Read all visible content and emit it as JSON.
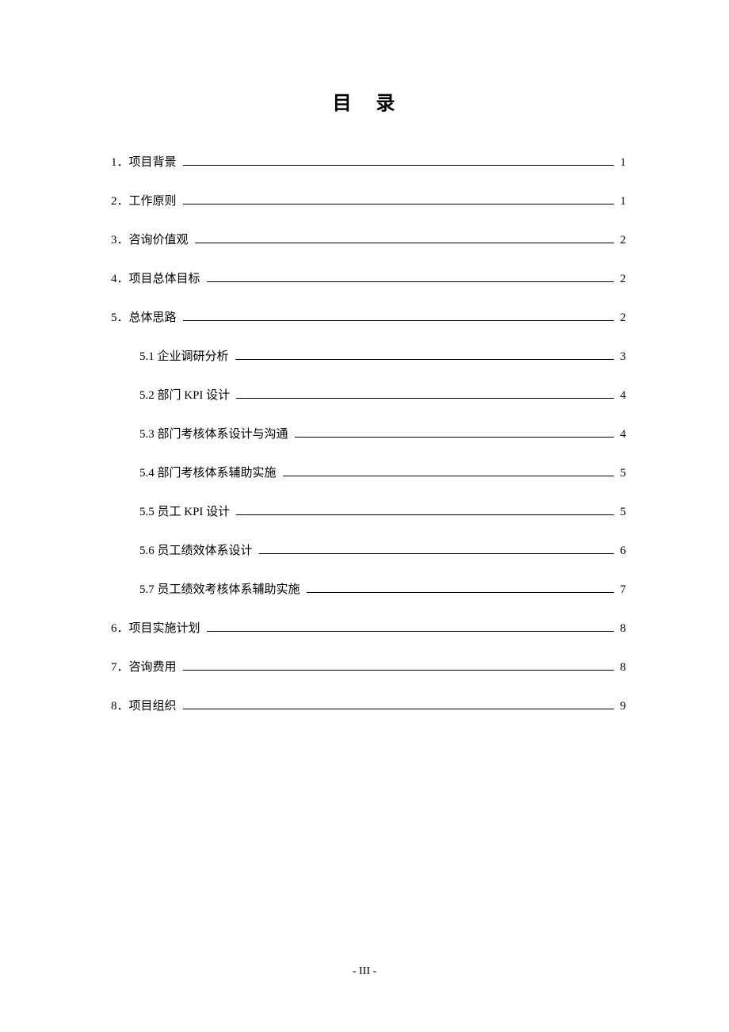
{
  "title": "目 录",
  "entries": [
    {
      "level": 1,
      "label": "1．项目背景",
      "page": "1"
    },
    {
      "level": 1,
      "label": "2．工作原则",
      "page": "1"
    },
    {
      "level": 1,
      "label": "3．咨询价值观",
      "page": "2"
    },
    {
      "level": 1,
      "label": "4．项目总体目标",
      "page": "2"
    },
    {
      "level": 1,
      "label": "5．总体思路",
      "page": "2"
    },
    {
      "level": 2,
      "label": "5.1  企业调研分析",
      "page": "3"
    },
    {
      "level": 2,
      "label": "5.2  部门 KPI 设计",
      "page": "4"
    },
    {
      "level": 2,
      "label": "5.3  部门考核体系设计与沟通",
      "page": "4"
    },
    {
      "level": 2,
      "label": "5.4  部门考核体系辅助实施",
      "page": "5"
    },
    {
      "level": 2,
      "label": "5.5  员工 KPI 设计",
      "page": "5"
    },
    {
      "level": 2,
      "label": "5.6  员工绩效体系设计",
      "page": "6"
    },
    {
      "level": 2,
      "label": "5.7  员工绩效考核体系辅助实施",
      "page": "7"
    },
    {
      "level": 1,
      "label": "6．项目实施计划",
      "page": "8"
    },
    {
      "level": 1,
      "label": "7．咨询费用",
      "page": "8"
    },
    {
      "level": 1,
      "label": "8．项目组织",
      "page": "9"
    }
  ],
  "page_number": "- III -"
}
